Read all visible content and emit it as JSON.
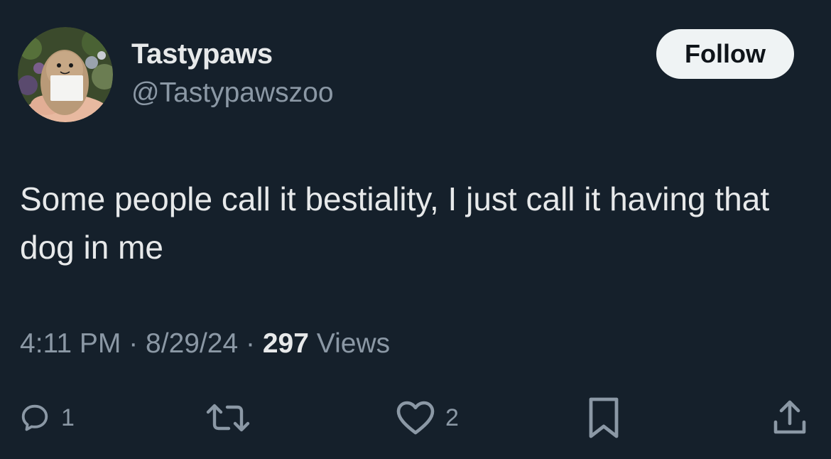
{
  "author": {
    "name": "Tastypaws",
    "handle": "@Tastypawszoo",
    "avatar_icon": "crochet-figure-avatar"
  },
  "follow_label": "Follow",
  "tweet": {
    "text": "Some people call it bestiality, I just call it having that dog in me"
  },
  "meta": {
    "time": "4:11 PM",
    "separator": "·",
    "date": "8/29/24",
    "views_count": "297",
    "views_label": "Views"
  },
  "actions": {
    "reply_count": "1",
    "repost_count": "",
    "like_count": "2"
  },
  "colors": {
    "background": "#15202b",
    "primary_text": "#e7e9ea",
    "secondary_text": "#8b98a5",
    "follow_button_bg": "#eff3f4"
  }
}
